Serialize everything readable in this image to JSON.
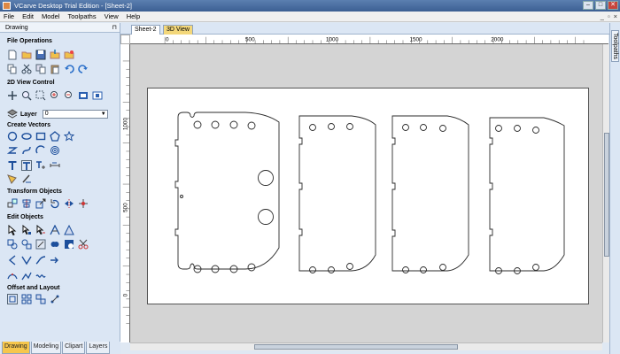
{
  "window": {
    "title": "VCarve Desktop Trial Edition - [Sheet-2]"
  },
  "menu": [
    {
      "label": "File",
      "key": "F"
    },
    {
      "label": "Edit",
      "key": "E"
    },
    {
      "label": "Model",
      "key": "M"
    },
    {
      "label": "Toolpaths",
      "key": ""
    },
    {
      "label": "View",
      "key": "V"
    },
    {
      "label": "Help",
      "key": "H"
    }
  ],
  "panel": {
    "title": "Drawing",
    "sections": {
      "file_operations": "File Operations",
      "view_control": "2D View Control",
      "create_vectors": "Create Vectors",
      "transform_objects": "Transform Objects",
      "edit_objects": "Edit Objects",
      "offset_layout": "Offset and Layout"
    },
    "layer": {
      "label": "Layer",
      "value": "0"
    }
  },
  "bottom_tabs": [
    "Drawing",
    "Modeling",
    "Clipart",
    "Layers"
  ],
  "doc_tabs": {
    "sheet": "Sheet-2",
    "view3d": "3D View"
  },
  "right_tab": "Toolpaths",
  "ruler": {
    "h_labels": [
      "0",
      "500",
      "1000",
      "1500",
      "2000"
    ],
    "v_labels": [
      "1000",
      "500",
      "0"
    ]
  },
  "colors": {
    "active_tab": "#f6c64c",
    "view3d_tab": "#f3d77a",
    "panel_bg": "#dbe6f4",
    "vector_stroke": "#2b2b2b"
  }
}
